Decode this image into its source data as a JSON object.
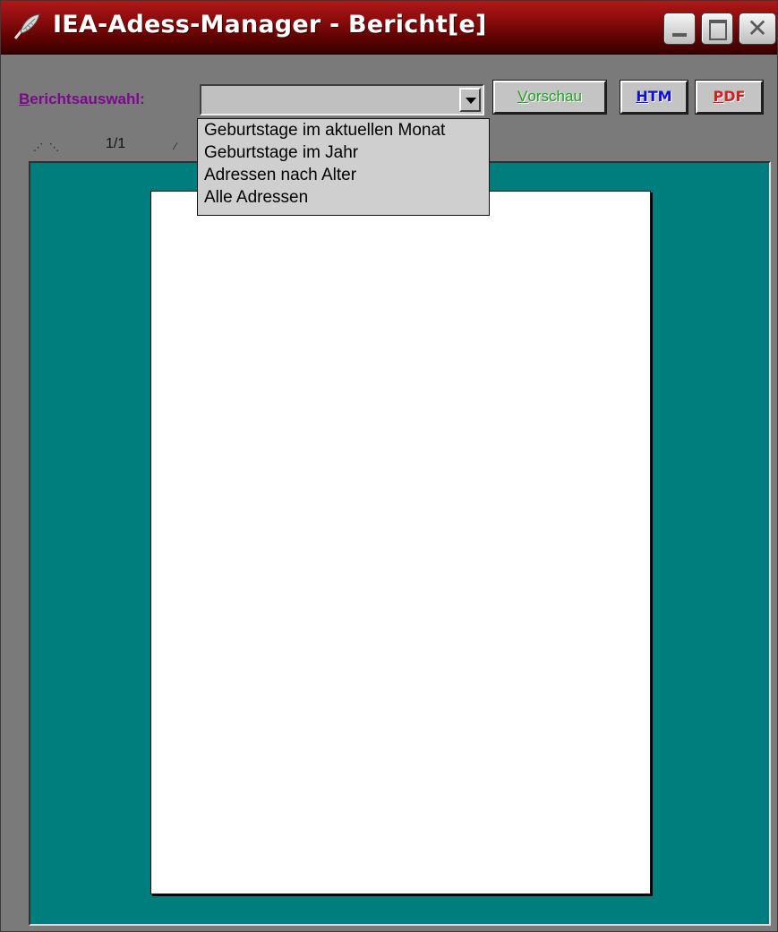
{
  "window": {
    "title": "IEA-Adess-Manager - Bericht[e]",
    "close_glyph": "✕"
  },
  "toolbar": {
    "label_first": "B",
    "label_rest": "erichtsauswahl:",
    "report_select_value": "",
    "preview_button": {
      "first": "V",
      "rest": "orschau"
    },
    "htm_button": {
      "first": "H",
      "rest": "TM"
    },
    "pdf_button": {
      "first": "P",
      "rest": "DF"
    }
  },
  "navigation": {
    "prev_arrows": "⋰ ⋱",
    "page_indicator": "1/1",
    "next_arrows": "⁄"
  },
  "dropdown": {
    "options": [
      "Geburtstage im aktuellen Monat",
      "Geburtstage im Jahr",
      "Adressen nach Alter",
      "Alle Adressen"
    ]
  },
  "colors": {
    "titlebar": "#8c0c0c",
    "preview_background": "#007d7d",
    "label": "#7a0a8c",
    "vorschau_text": "#1f9e1f",
    "htm_text": "#1010d0",
    "pdf_text": "#d02020"
  },
  "icons": {
    "app": "quill-pen-icon",
    "minimize": "minimize-icon",
    "maximize": "maximize-icon",
    "close": "close-icon",
    "dropdown": "chevron-down-icon"
  }
}
